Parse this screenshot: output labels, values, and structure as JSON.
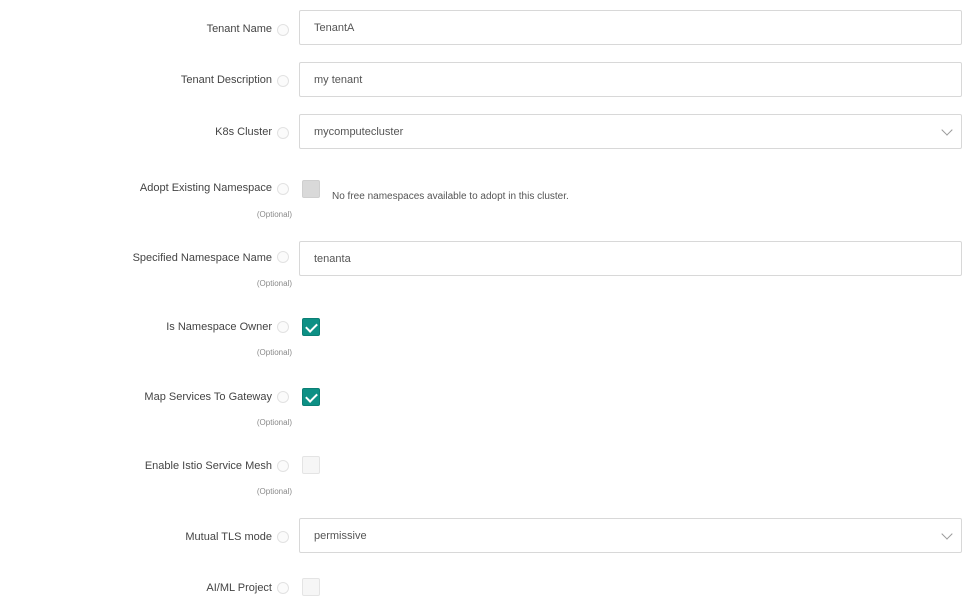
{
  "fields": {
    "tenant_name": {
      "label": "Tenant Name",
      "value": "TenantA"
    },
    "tenant_description": {
      "label": "Tenant Description",
      "value": "my tenant"
    },
    "k8s_cluster": {
      "label": "K8s Cluster",
      "value": "mycomputecluster"
    },
    "adopt_namespace": {
      "label": "Adopt Existing Namespace",
      "optional": "(Optional)",
      "note": "No free namespaces available to adopt in this cluster."
    },
    "namespace_name": {
      "label": "Specified Namespace Name",
      "optional": "(Optional)",
      "value": "tenanta"
    },
    "namespace_owner": {
      "label": "Is Namespace Owner",
      "optional": "(Optional)",
      "checked": true
    },
    "map_services": {
      "label": "Map Services To Gateway",
      "optional": "(Optional)",
      "checked": true
    },
    "istio_mesh": {
      "label": "Enable Istio Service Mesh",
      "optional": "(Optional)",
      "checked": false
    },
    "mtls_mode": {
      "label": "Mutual TLS mode",
      "value": "permissive"
    },
    "aiml_project": {
      "label": "AI/ML Project",
      "checked": false
    }
  },
  "colors": {
    "accent": "#0d9085",
    "border": "#d8d8d8"
  }
}
